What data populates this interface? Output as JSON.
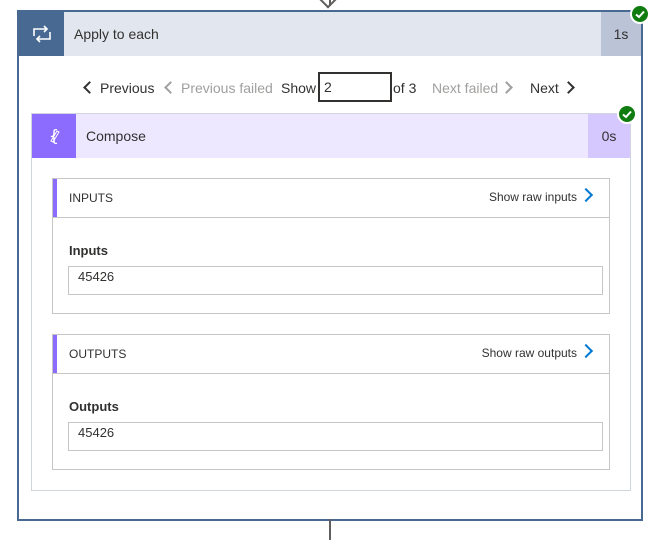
{
  "loop": {
    "title": "Apply to each",
    "duration": "1s",
    "status": "succeeded",
    "icon": "loop-icon"
  },
  "pager": {
    "previous": "Previous",
    "previous_failed": "Previous failed",
    "show_label": "Show",
    "current_page": "2",
    "of_total": "of 3",
    "next_failed": "Next failed",
    "next": "Next"
  },
  "compose": {
    "title": "Compose",
    "duration": "0s",
    "status": "succeeded",
    "icon": "compose-icon"
  },
  "inputs": {
    "header": "INPUTS",
    "raw_link": "Show raw inputs",
    "label": "Inputs",
    "value": "45426"
  },
  "outputs": {
    "header": "OUTPUTS",
    "raw_link": "Show raw outputs",
    "label": "Outputs",
    "value": "45426"
  },
  "colors": {
    "loop_accent": "#486991",
    "compose_accent": "#8c6cff",
    "success": "#107c10",
    "link_blue": "#0078d4"
  }
}
